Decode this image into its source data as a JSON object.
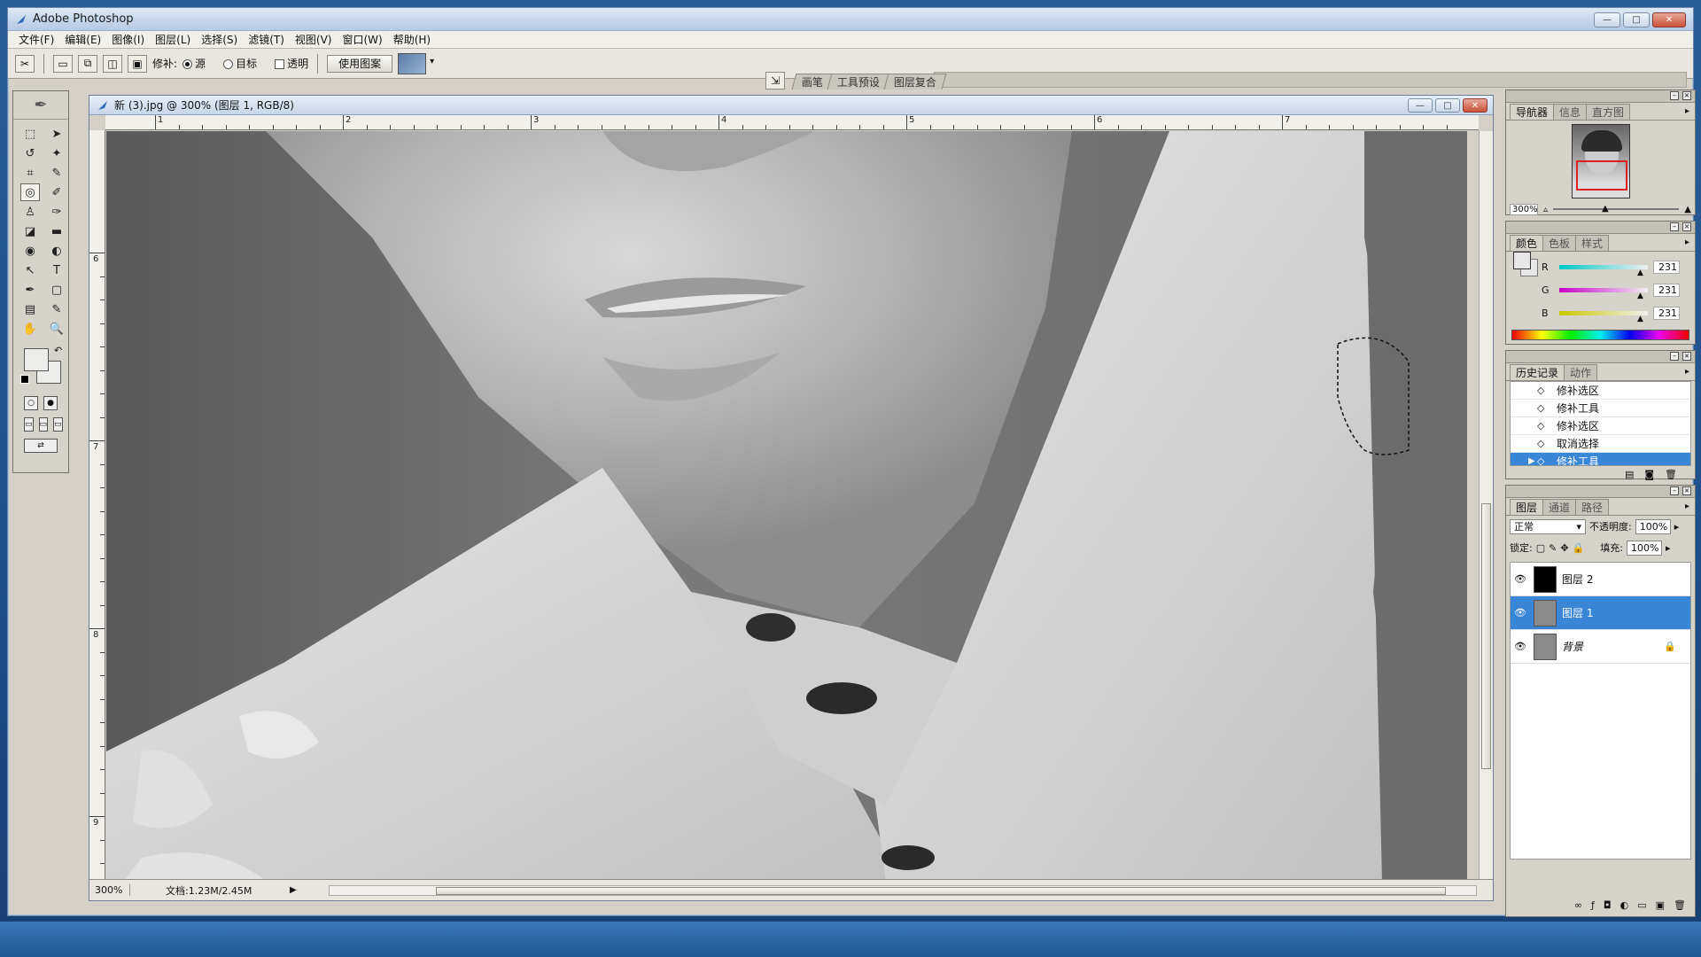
{
  "app": {
    "title": "Adobe Photoshop"
  },
  "window_controls": {
    "minimize": "—",
    "maximize": "□",
    "close": "✕"
  },
  "menu": [
    "文件(F)",
    "编辑(E)",
    "图像(I)",
    "图层(L)",
    "选择(S)",
    "滤镜(T)",
    "视图(V)",
    "窗口(W)",
    "帮助(H)"
  ],
  "options": {
    "patch_label": "修补:",
    "source_label": "源",
    "destination_label": "目标",
    "transparent_label": "透明",
    "use_pattern_button": "使用图案",
    "source_selected": true
  },
  "wells": [
    "画笔",
    "工具预设",
    "图层复合"
  ],
  "document": {
    "title": "新 (3).jpg @ 300% (图层 1, RGB/8)",
    "zoom": "300%",
    "doc_info": "文档:1.23M/2.45M",
    "ruler_h": [
      "1",
      "2",
      "3",
      "4",
      "5",
      "6",
      "7"
    ],
    "ruler_v": [
      "6",
      "7",
      "8",
      "9"
    ]
  },
  "navigator": {
    "tabs": [
      "导航器",
      "信息",
      "直方图"
    ],
    "zoom": "300%"
  },
  "color_panel": {
    "tabs": [
      "颜色",
      "色板",
      "样式"
    ],
    "channels": [
      {
        "label": "R",
        "value": "231",
        "gradient": "#00c8c8"
      },
      {
        "label": "G",
        "value": "231",
        "gradient": "#c800c8"
      },
      {
        "label": "B",
        "value": "231",
        "gradient": "#c8c800"
      }
    ],
    "foreground": "#e7e7e7"
  },
  "history": {
    "tabs": [
      "历史记录",
      "动作"
    ],
    "items": [
      {
        "label": "修补选区",
        "selected": false
      },
      {
        "label": "修补工具",
        "selected": false
      },
      {
        "label": "修补选区",
        "selected": false
      },
      {
        "label": "取消选择",
        "selected": false
      },
      {
        "label": "修补工具",
        "selected": true
      }
    ]
  },
  "layers": {
    "tabs": [
      "图层",
      "通道",
      "路径"
    ],
    "blend_mode": "正常",
    "opacity_label": "不透明度:",
    "opacity": "100%",
    "lock_label": "锁定:",
    "fill_label": "填充:",
    "fill": "100%",
    "items": [
      {
        "name": "图层 2",
        "selected": false,
        "thumb": "#000000",
        "locked": false
      },
      {
        "name": "图层 1",
        "selected": true,
        "thumb": "#8a8a8a",
        "locked": false
      },
      {
        "name": "背景",
        "selected": false,
        "thumb": "#8a8a8a",
        "locked": true
      }
    ]
  },
  "colors": {
    "selection_blue": "#3a86d6",
    "chrome": "#d4d0c8",
    "navigator_box": "#e02020"
  }
}
